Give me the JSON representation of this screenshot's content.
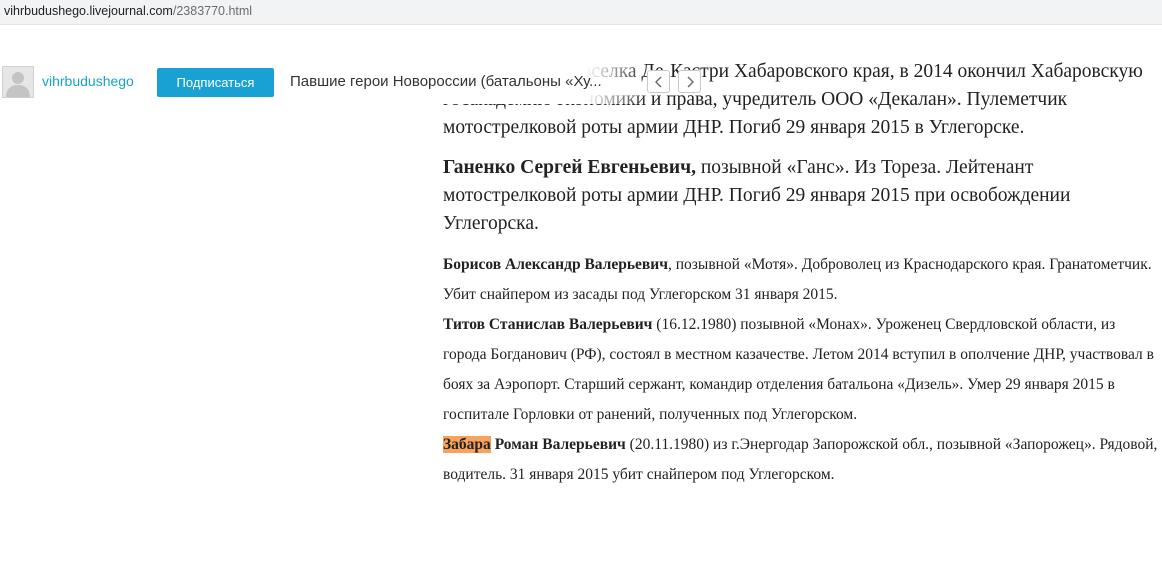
{
  "browser": {
    "url_domain": "vihrbudushego.livejournal.com",
    "url_path": "/2383770.html"
  },
  "header": {
    "username": "vihrbudushego",
    "subscribe_label": "Подписаться",
    "post_title": "Павшие герои Новороссии (батальоны «Ху...",
    "prev_icon": "chevron-left-icon",
    "next_icon": "chevron-right-icon",
    "accent_color": "#1aa1d3"
  },
  "article": {
    "p1_text": "Доброволец из поселка Де-Кастри Хабаровского края, в 2014 окончил Хабаровскую госакадемию экономики и права, учредитель ООО «Декалан». Пулеметчик мотострелковой роты армии ДНР. Погиб 29 января 2015 в Углегорске.",
    "p2_name": "Ганенко Сергей Евгеньевич,",
    "p2_text": " позывной «Ганс». Из Тореза. Лейтенант мотострелковой роты армии ДНР. Погиб 29 января 2015 при освобождении Углегорска.",
    "p3_name": "Борисов Александр Валерьевич",
    "p3_text": ", позывной «Мотя». Доброволец из Краснодарского края. Гранатометчик. Убит снайпером из засады под Углегорском 31 января 2015.",
    "p4_name": "Титов Станислав Валерьевич",
    "p4_text": " (16.12.1980) позывной «Монах». Уроженец Свердловской области, из города Богданович (РФ), состоял в местном казачестве. Летом 2014 вступил в ополчение ДНР, участвовал в боях за Аэропорт. Старший сержант, командир отделения батальона «Дизель». Умер 29 января 2015 в госпитале Горловки от ранений, полученных под Углегорском.",
    "p5_highlight": "Забара",
    "p5_name": " Роман Валерьевич",
    "p5_text": " (20.11.1980) из г.Энергодар Запорожской обл., позывной «Запорожец». Рядовой, водитель. 31 января 2015 убит снайпером под Углегорском.",
    "highlight_color": "#f7a35c"
  }
}
